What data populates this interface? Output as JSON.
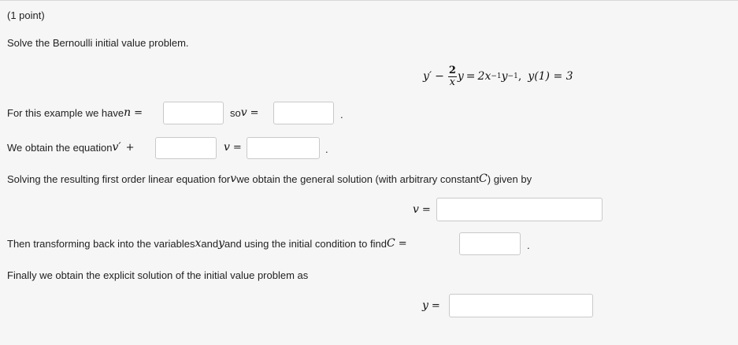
{
  "header": {
    "points": "(1 point)"
  },
  "problem": {
    "instruction": "Solve the Bernoulli initial value problem.",
    "equation": {
      "lhs_prime": "y′",
      "minus": "−",
      "frac_num": "2",
      "frac_den": "x",
      "y": "y",
      "eq": "=",
      "rhs": "2x",
      "exp1": "−1",
      "rhs_y": "y",
      "exp2": "−1",
      "comma": ",",
      "ic": "y(1) = 3"
    }
  },
  "line_n": {
    "text1": "For this example we have ",
    "n_sym": "n",
    "eq": "=",
    "so": "so ",
    "v_sym": "v",
    "eq2": "=",
    "period": "."
  },
  "line_eq": {
    "text1": "We obtain the equation ",
    "vprime": "v′",
    "plus": "+",
    "v_sym": "v",
    "eq": "=",
    "period": "."
  },
  "line_general": {
    "text1": "Solving the resulting first order linear equation for ",
    "v_sym": "v",
    "text2": " we obtain the general solution (with arbitrary constant ",
    "c_sym": "C",
    "text3": ") given by"
  },
  "line_v": {
    "v_sym": "v",
    "eq": "="
  },
  "line_transform": {
    "text1": "Then transforming back into the variables ",
    "x_sym": "x",
    "and": " and ",
    "y_sym": "y",
    "text2": " and using the initial condition to find ",
    "c_sym": "C",
    "eq": "=",
    "period": "."
  },
  "line_finally": {
    "text1": "Finally we obtain the explicit solution of the initial value problem as"
  },
  "line_y": {
    "y_sym": "y",
    "eq": "="
  },
  "inputs": {
    "n_value": "",
    "v_sub_value": "",
    "coef_value": "",
    "rhs_value": "",
    "general_value": "",
    "c_value": "",
    "y_value": ""
  }
}
